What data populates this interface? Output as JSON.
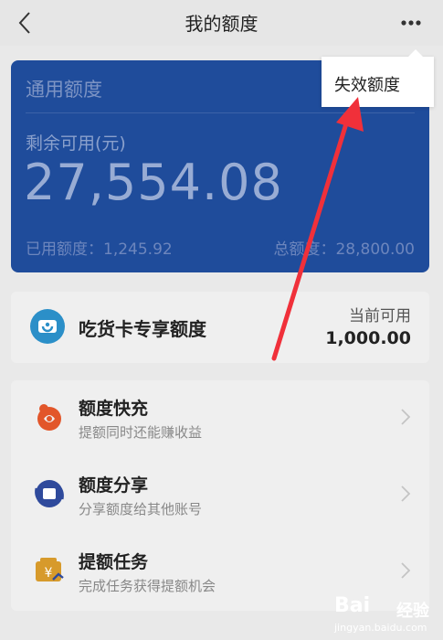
{
  "navbar": {
    "title": "我的额度"
  },
  "credit_card": {
    "title": "通用额度",
    "remaining_label": "剩余可用(元)",
    "remaining_amount": "27,554.08",
    "used_label": "已用额度：",
    "used_value": "1,245.92",
    "total_label": "总额度：",
    "total_value": "28,800.00"
  },
  "menu_popup": {
    "item_label": "失效额度"
  },
  "snack_card": {
    "label": "吃货卡专享额度",
    "available_label": "当前可用",
    "available_amount": "1,000.00"
  },
  "features": [
    {
      "title": "额度快充",
      "subtitle": "提额同时还能赚收益",
      "icon": "quick-charge-icon"
    },
    {
      "title": "额度分享",
      "subtitle": "分享额度给其他账号",
      "icon": "share-icon"
    },
    {
      "title": "提额任务",
      "subtitle": "完成任务获得提额机会",
      "icon": "task-icon"
    }
  ],
  "watermark": {
    "logo": "Bai",
    "text": "经验",
    "url": "jingyan.baidu.com"
  },
  "colors": {
    "card_blue": "#1f4c9b",
    "arrow_red": "#f0303a",
    "icon_orange": "#e2562a",
    "icon_blue": "#2f4a9c",
    "icon_gold": "#d79a2b"
  }
}
